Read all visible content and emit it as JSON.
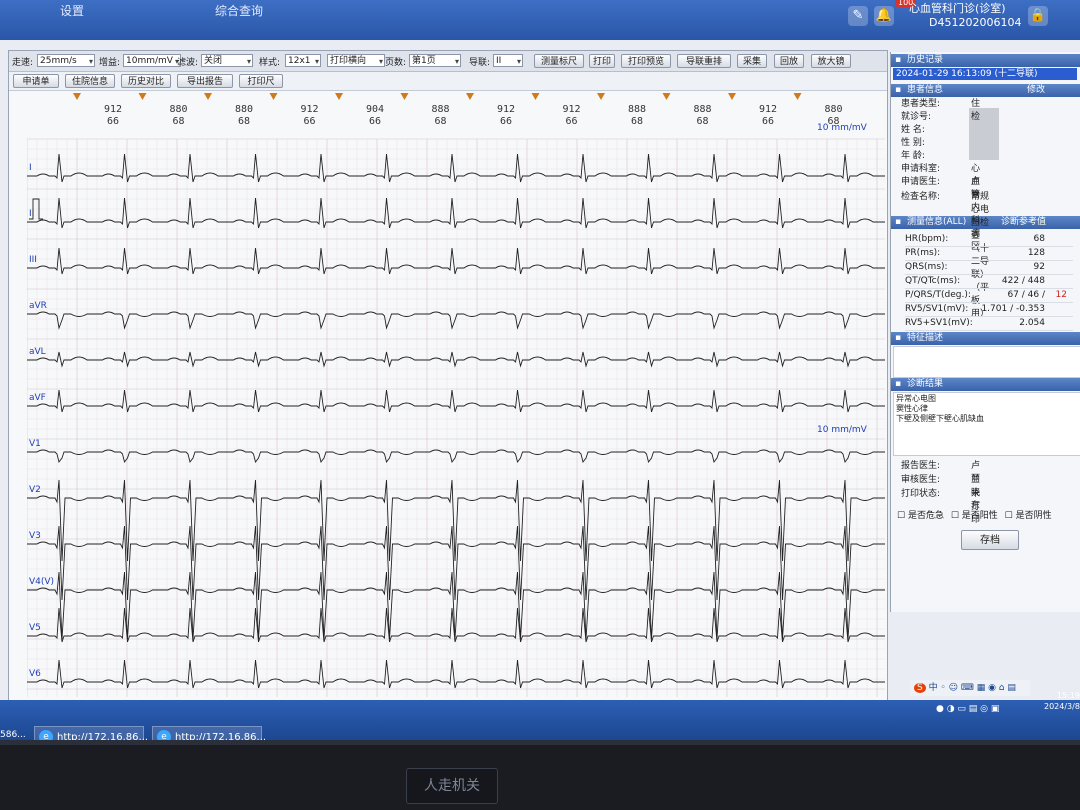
{
  "topbar": {
    "menu_items": [
      "设置",
      "综合查询"
    ],
    "device_line1": "心血管科门诊(诊室)",
    "device_id": "D451202006104",
    "badge": "100"
  },
  "toolbar": {
    "speed_label": "走速:",
    "speed_value": "25mm/s",
    "gain_label": "增益:",
    "gain_value": "10mm/mV",
    "filter_label": "滤波:",
    "filter_value": "关闭",
    "style_label": "样式:",
    "style_value": "12x1",
    "print_value": "打印横向",
    "page_label": "页数:",
    "page_value": "第1页",
    "lead_label": "导联:",
    "lead_value": "II",
    "buttons": [
      "测量标尺",
      "打印",
      "打印预览",
      "导联重排",
      "采集",
      "回放",
      "放大镜"
    ]
  },
  "toolbar2": {
    "buttons": [
      "申请单",
      "住院信息",
      "历史对比",
      "导出报告",
      "打印尺"
    ]
  },
  "ecg": {
    "rr_numbers": [
      "912",
      "880",
      "880",
      "912",
      "904",
      "888",
      "912",
      "912",
      "888",
      "888",
      "912",
      "880"
    ],
    "hr_numbers": [
      "66",
      "68",
      "68",
      "66",
      "66",
      "68",
      "66",
      "66",
      "68",
      "68",
      "66",
      "68"
    ],
    "leads": [
      "I",
      "II",
      "III",
      "aVR",
      "aVL",
      "aVF",
      "V1",
      "V2",
      "V3",
      "V4",
      "V5",
      "V6"
    ],
    "scale_label_top": "10 mm/mV",
    "scale_label_v1": "10 mm/mV",
    "v4_extra": "V4(V)"
  },
  "side": {
    "history_title": "历史记录",
    "history_entry": "2024-01-29 16:13:09 (十二导联)",
    "patient_title": "患者信息",
    "patient_edit": "修改",
    "patient_rows": [
      {
        "k": "患者类型:",
        "v": "住检"
      },
      {
        "k": "就诊号:",
        "v": ""
      },
      {
        "k": "姓  名:",
        "v": ""
      },
      {
        "k": "性  别:",
        "v": ""
      },
      {
        "k": "年  龄:",
        "v": ""
      },
      {
        "k": "申请科室:",
        "v": "心血管内科病区"
      },
      {
        "k": "申请医生:",
        "v": "卢丽"
      },
      {
        "k": "检查名称:",
        "v": "常规心电图检查（十二导联）（平板用）"
      }
    ],
    "measure_title": "测量信息(ALL)",
    "measure_link": "诊断参考值",
    "measure_rows": [
      {
        "k": "HR(bpm):",
        "v": "68"
      },
      {
        "k": "PR(ms):",
        "v": "128"
      },
      {
        "k": "QRS(ms):",
        "v": "92"
      },
      {
        "k": "QT/QTc(ms):",
        "v": "422 / 448"
      },
      {
        "k": "P/QRS/T(deg.):",
        "v": "67 / 46 /",
        "v2": "12"
      },
      {
        "k": "RV5/SV1(mV):",
        "v": "1.701 / -0.353"
      },
      {
        "k": "RV5+SV1(mV):",
        "v": "2.054"
      }
    ],
    "feature_title": "特征描述",
    "diag_title": "诊断结果",
    "diag_lines": [
      "异常心电图",
      "窦性心律",
      "下壁及侧壁下壁心肌缺血"
    ],
    "report_rows": [
      {
        "k": "报告医生:",
        "v": "卢丽"
      },
      {
        "k": "审核医生:",
        "v": "兰晓东"
      },
      {
        "k": "打印状态:",
        "v": "未打印"
      }
    ],
    "checkboxes": [
      "是否危急",
      "是否阳性",
      "是否阴性"
    ],
    "submit": "存档"
  },
  "taskbar": {
    "tasks": [
      "http://172.16.86...",
      "http://172.16.86..."
    ],
    "time": "15:19",
    "date": "2024/3/8",
    "left_fragment": "586..."
  },
  "bezel": {
    "label": "人走机关"
  }
}
